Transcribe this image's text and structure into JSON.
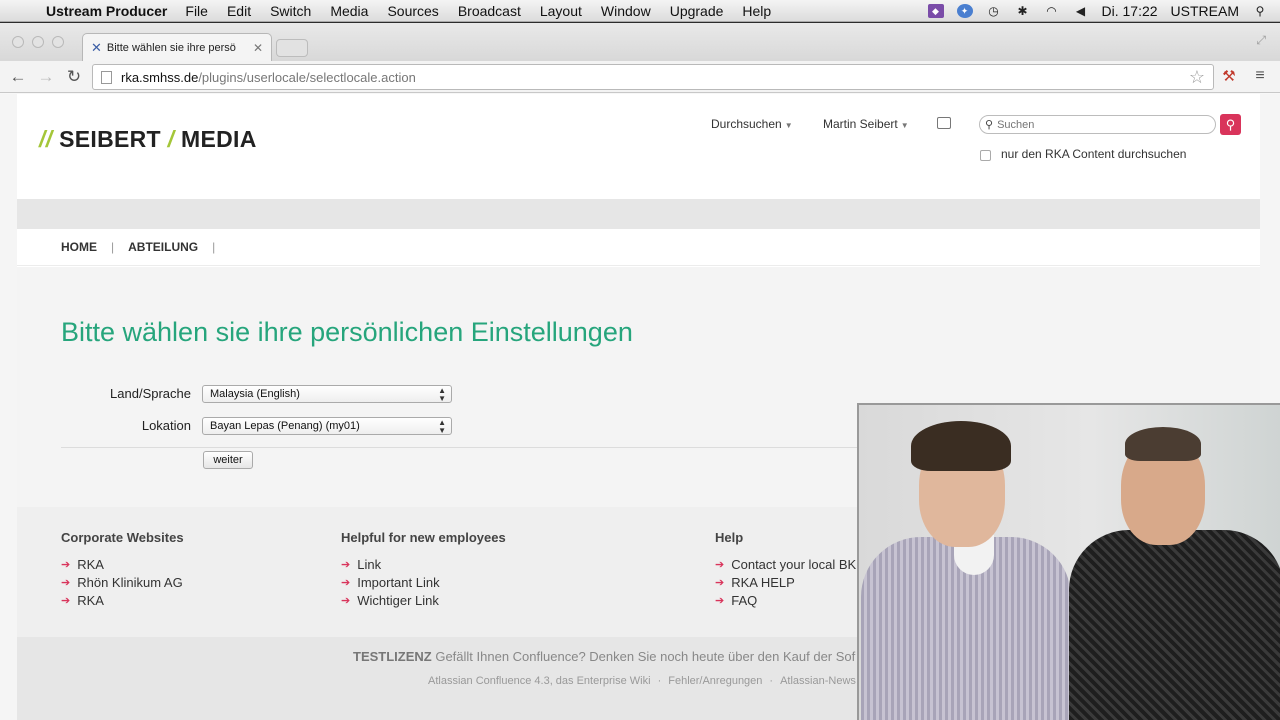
{
  "menubar": {
    "app_name": "Ustream Producer",
    "items": [
      "File",
      "Edit",
      "Switch",
      "Media",
      "Sources",
      "Broadcast",
      "Layout",
      "Window",
      "Upgrade",
      "Help"
    ],
    "clock": "Di. 17:22",
    "account": "USTREAM"
  },
  "browser": {
    "tab_title": "Bitte wählen sie ihre persö",
    "url_host": "rka.smhss.de",
    "url_path": "/plugins/userlocale/selectlocale.action"
  },
  "site": {
    "logo_word1": "SEIBERT",
    "logo_word2": "MEDIA",
    "browse_label": "Durchsuchen",
    "user_label": "Martin Seibert",
    "search_placeholder": "Suchen",
    "search_scope_label": "nur den RKA Content durchsuchen",
    "nav": [
      "HOME",
      "ABTEILUNG"
    ],
    "page_title": "Bitte wählen sie ihre persönlichen Einstellungen",
    "form": {
      "country_label": "Land/Sprache",
      "country_value": "Malaysia (English)",
      "location_label": "Lokation",
      "location_value": "Bayan Lepas (Penang) (my01)",
      "submit_label": "weiter"
    },
    "footer": {
      "col1": {
        "title": "Corporate Websites",
        "links": [
          "RKA",
          "Rhön Klinikum AG",
          "RKA"
        ]
      },
      "col2": {
        "title": "Helpful for new employees",
        "links": [
          "Link",
          "Important Link",
          "Wichtiger Link"
        ]
      },
      "col3": {
        "title": "Help",
        "links": [
          "Contact your local BK",
          "RKA HELP",
          "FAQ"
        ]
      },
      "license_strong": "TESTLIZENZ",
      "license_text": "Gefällt Ihnen Confluence? Denken Sie noch heute über den Kauf der Sof",
      "links": [
        "Atlassian Confluence 4.3, das Enterprise Wiki",
        "Fehler/Anregungen",
        "Atlassian-News"
      ]
    }
  },
  "colors": {
    "title_green": "#26a57c",
    "logo_slash": "#a4c639",
    "search_button": "#d9345b"
  }
}
